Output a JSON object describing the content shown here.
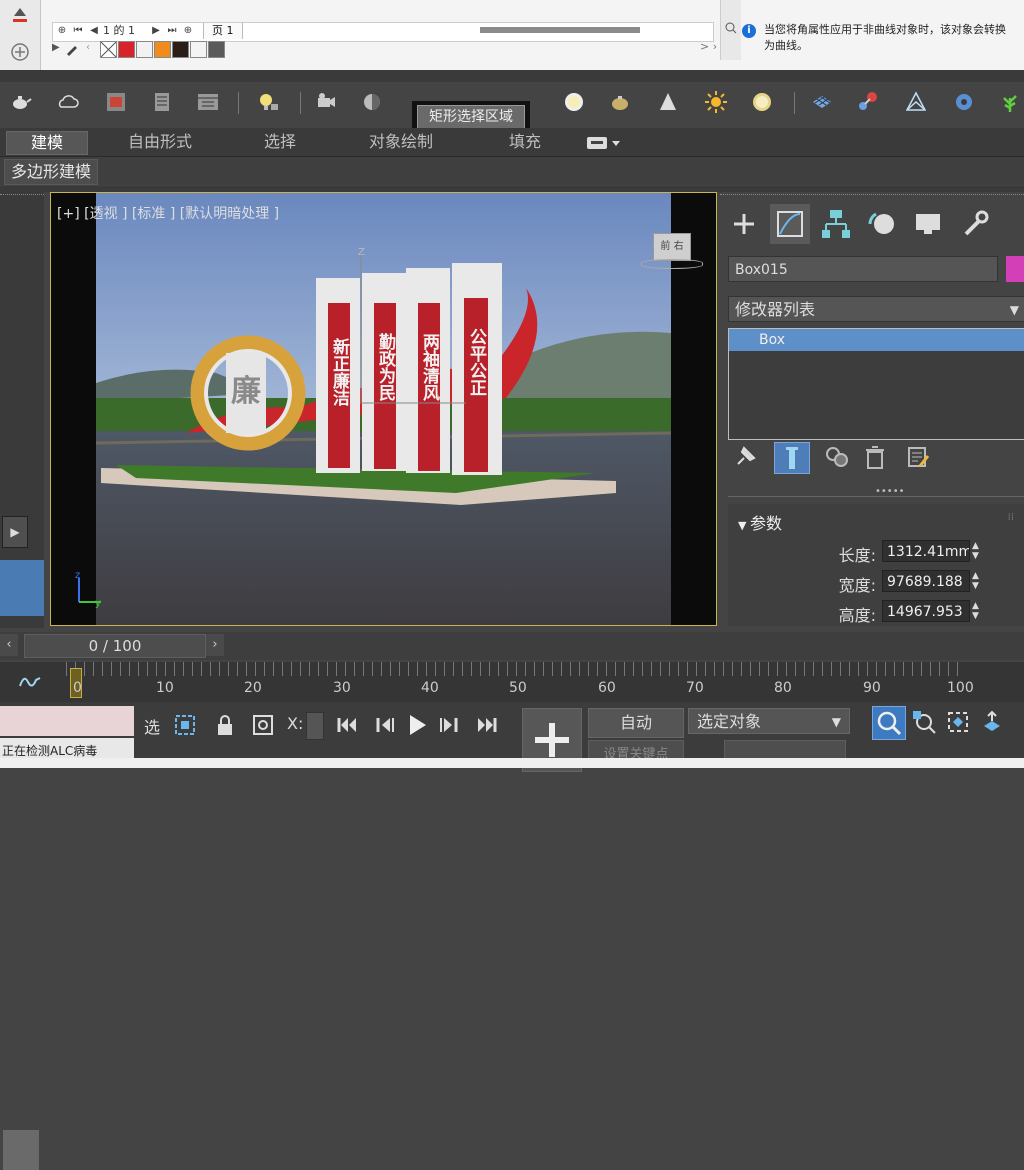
{
  "topbar": {
    "page_counter": "1 的 1",
    "page_tab": "页 1",
    "notice": "当您将角属性应用于非曲线对象时，该对象会转换为曲线。"
  },
  "toolbar": {
    "tooltip": "矩形选择区域",
    "icons": [
      "teapot-icon",
      "cloud-icon",
      "render-frame-icon",
      "render-setup-icon",
      "rendered-frame-window-icon",
      "light-bulb-icon",
      "camera-icon",
      "material-editor-icon",
      "sphere-icon",
      "teapot-material-icon",
      "cone-icon",
      "sun-icon",
      "light-sphere-icon",
      "grid-cube-icon",
      "molecule-icon",
      "envelope-icon",
      "gear-icon",
      "plant-icon"
    ]
  },
  "ribbon": {
    "tabs": [
      "建模",
      "自由形式",
      "选择",
      "对象绘制",
      "填充"
    ],
    "active_tab": "建模",
    "sub_tab": "多边形建模"
  },
  "viewport": {
    "label": "[+] [透视 ] [标准 ] [默认明暗处理 ]",
    "viewcube_label": "前 右",
    "scene_texts": [
      "廉",
      "新正廉洁",
      "勤政为民",
      "两袖清风",
      "公平公正"
    ]
  },
  "command_panel": {
    "object_name": "Box015",
    "object_color": "#d23fb6",
    "modifier_list": "修改器列表",
    "stack_item": "Box",
    "params_title": "参数",
    "params": [
      {
        "label": "长度:",
        "value": "1312.41mm"
      },
      {
        "label": "宽度:",
        "value": "97689.188"
      },
      {
        "label": "高度:",
        "value": "14967.953"
      }
    ]
  },
  "timeline": {
    "frame_display": "0 / 100",
    "ticks": [
      "0",
      "10",
      "20",
      "30",
      "40",
      "50",
      "60",
      "70",
      "80",
      "90",
      "100"
    ]
  },
  "bottom": {
    "status_text": "正在检测ALC病毒",
    "select_label": "选",
    "x_label": "X:",
    "auto_key": "自动",
    "selection_set": "选定对象",
    "set_key": "设置关键点"
  },
  "colors": {
    "app_background": "#444444",
    "active_blue": "#5d8fc9",
    "viewport_border": "#cbb44a"
  }
}
